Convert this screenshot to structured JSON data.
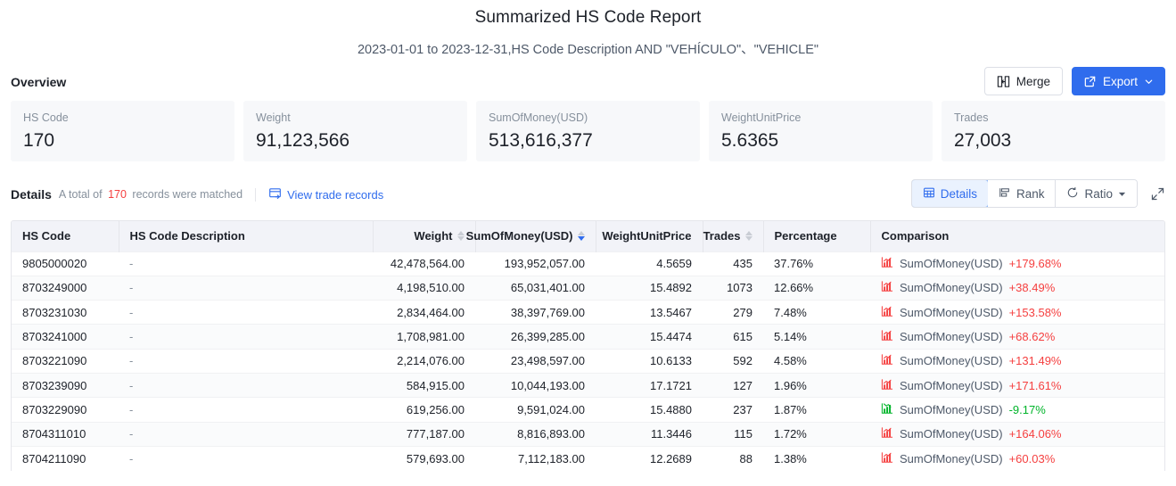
{
  "header": {
    "title": "Summarized HS Code Report",
    "subtitle": "2023-01-01 to 2023-12-31,HS Code Description AND \"VEHÍCULO\"、\"VEHICLE\""
  },
  "overview": {
    "label": "Overview",
    "merge_label": "Merge",
    "export_label": "Export",
    "cards": [
      {
        "label": "HS Code",
        "value": "170"
      },
      {
        "label": "Weight",
        "value": "91,123,566"
      },
      {
        "label": "SumOfMoney(USD)",
        "value": "513,616,377"
      },
      {
        "label": "WeightUnitPrice",
        "value": "5.6365"
      },
      {
        "label": "Trades",
        "value": "27,003"
      }
    ]
  },
  "details": {
    "title": "Details",
    "meta_prefix": "A total of",
    "count": "170",
    "meta_suffix": "records were matched",
    "view_records_label": "View trade records",
    "tab_details": "Details",
    "tab_rank": "Rank",
    "tab_ratio": "Ratio"
  },
  "table": {
    "columns": [
      {
        "label": "HS Code",
        "align": "left",
        "sortable": false
      },
      {
        "label": "HS Code Description",
        "align": "left",
        "sortable": false
      },
      {
        "label": "Weight",
        "align": "right",
        "sortable": true,
        "sort": "none"
      },
      {
        "label": "SumOfMoney(USD)",
        "align": "right",
        "sortable": true,
        "sort": "desc"
      },
      {
        "label": "WeightUnitPrice",
        "align": "right",
        "sortable": false
      },
      {
        "label": "Trades",
        "align": "right",
        "sortable": true,
        "sort": "none"
      },
      {
        "label": "Percentage",
        "align": "left",
        "sortable": false
      },
      {
        "label": "Comparison",
        "align": "left",
        "sortable": false
      }
    ],
    "rows": [
      {
        "hs_code": "9805000020",
        "description": "-",
        "weight": "42,478,564.00",
        "sum_of_money": "193,952,057.00",
        "weight_unit_price": "4.5659",
        "trades": "435",
        "percentage": "37.76%",
        "cmp_label": "SumOfMoney(USD)",
        "cmp_value": "+179.68%",
        "cmp_dir": "up"
      },
      {
        "hs_code": "8703249000",
        "description": "-",
        "weight": "4,198,510.00",
        "sum_of_money": "65,031,401.00",
        "weight_unit_price": "15.4892",
        "trades": "1073",
        "percentage": "12.66%",
        "cmp_label": "SumOfMoney(USD)",
        "cmp_value": "+38.49%",
        "cmp_dir": "up"
      },
      {
        "hs_code": "8703231030",
        "description": "-",
        "weight": "2,834,464.00",
        "sum_of_money": "38,397,769.00",
        "weight_unit_price": "13.5467",
        "trades": "279",
        "percentage": "7.48%",
        "cmp_label": "SumOfMoney(USD)",
        "cmp_value": "+153.58%",
        "cmp_dir": "up"
      },
      {
        "hs_code": "8703241000",
        "description": "-",
        "weight": "1,708,981.00",
        "sum_of_money": "26,399,285.00",
        "weight_unit_price": "15.4474",
        "trades": "615",
        "percentage": "5.14%",
        "cmp_label": "SumOfMoney(USD)",
        "cmp_value": "+68.62%",
        "cmp_dir": "up"
      },
      {
        "hs_code": "8703221090",
        "description": "-",
        "weight": "2,214,076.00",
        "sum_of_money": "23,498,597.00",
        "weight_unit_price": "10.6133",
        "trades": "592",
        "percentage": "4.58%",
        "cmp_label": "SumOfMoney(USD)",
        "cmp_value": "+131.49%",
        "cmp_dir": "up"
      },
      {
        "hs_code": "8703239090",
        "description": "-",
        "weight": "584,915.00",
        "sum_of_money": "10,044,193.00",
        "weight_unit_price": "17.1721",
        "trades": "127",
        "percentage": "1.96%",
        "cmp_label": "SumOfMoney(USD)",
        "cmp_value": "+171.61%",
        "cmp_dir": "up"
      },
      {
        "hs_code": "8703229090",
        "description": "-",
        "weight": "619,256.00",
        "sum_of_money": "9,591,024.00",
        "weight_unit_price": "15.4880",
        "trades": "237",
        "percentage": "1.87%",
        "cmp_label": "SumOfMoney(USD)",
        "cmp_value": "-9.17%",
        "cmp_dir": "down"
      },
      {
        "hs_code": "8704311010",
        "description": "-",
        "weight": "777,187.00",
        "sum_of_money": "8,816,893.00",
        "weight_unit_price": "11.3446",
        "trades": "115",
        "percentage": "1.72%",
        "cmp_label": "SumOfMoney(USD)",
        "cmp_value": "+164.06%",
        "cmp_dir": "up"
      },
      {
        "hs_code": "8704211090",
        "description": "-",
        "weight": "579,693.00",
        "sum_of_money": "7,112,183.00",
        "weight_unit_price": "12.2689",
        "trades": "88",
        "percentage": "1.38%",
        "cmp_label": "SumOfMoney(USD)",
        "cmp_value": "+60.03%",
        "cmp_dir": "up"
      }
    ]
  },
  "colors": {
    "primary": "#2f6ced",
    "up": "#f53f3f",
    "down": "#00b42a",
    "card_bg": "#f7f8fa",
    "header_bg": "#f2f3f8"
  }
}
